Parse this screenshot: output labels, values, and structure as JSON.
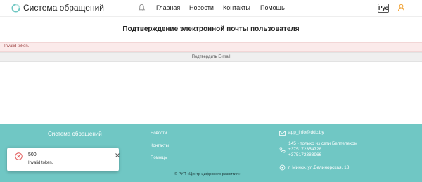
{
  "header": {
    "site_title": "Система обращений",
    "nav": [
      "Главная",
      "Новости",
      "Контакты",
      "Помощь"
    ],
    "lang": "Рус",
    "icons": [
      "logo-icon",
      "bell-icon",
      "user-icon"
    ]
  },
  "main": {
    "title": "Подтверждение электронной почты пользователя",
    "alert": "Invalid token.",
    "confirm_label": "Подтвердить E-mail"
  },
  "footer": {
    "brand": "Система обращений",
    "links": [
      "Новости",
      "Контакты",
      "Помощь"
    ],
    "email": "app_info@ddc.by",
    "phone_note": "145 - только из сети Белтелеком",
    "phone1": "+375172354728",
    "phone2": "+375172383966",
    "address": "г. Минск, ул.Белинорская, 18",
    "copyright": "© РУП «Центр цифрового развития»"
  },
  "toast": {
    "code": "500",
    "message": "Invalid token."
  },
  "colors": {
    "footer_bg": "#70c7c4",
    "accent_orange": "#f0a030",
    "error_red": "#e05050",
    "alert_bg": "#fbeaea"
  }
}
